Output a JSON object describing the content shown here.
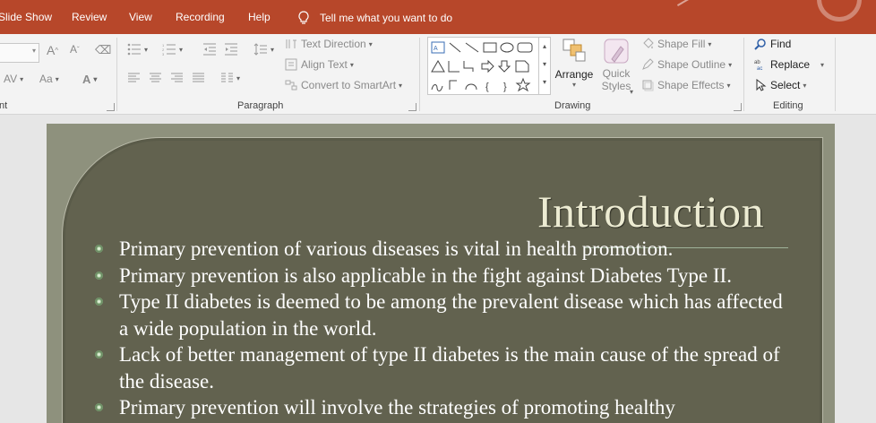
{
  "menu": {
    "tabs": [
      "Slide Show",
      "Review",
      "View",
      "Recording",
      "Help"
    ],
    "tell_me": "Tell me what you want to do"
  },
  "ribbon": {
    "font": {
      "group_label": "nt"
    },
    "paragraph": {
      "group_label": "Paragraph",
      "text_direction": "Text Direction",
      "align_text": "Align Text",
      "convert_smartart": "Convert to SmartArt"
    },
    "drawing": {
      "group_label": "Drawing",
      "arrange": "Arrange",
      "quick_styles_1": "Quick",
      "quick_styles_2": "Styles",
      "shape_fill": "Shape Fill",
      "shape_outline": "Shape Outline",
      "shape_effects": "Shape Effects"
    },
    "editing": {
      "group_label": "Editing",
      "find": "Find",
      "replace": "Replace",
      "select": "Select"
    }
  },
  "slide": {
    "title": "Introduction",
    "bullets": [
      "Primary prevention of various diseases is vital in health promotion.",
      "Primary prevention is also applicable in the fight against Diabetes Type II.",
      "Type II diabetes is deemed to be among the prevalent disease which has affected a wide population in the world.",
      "Lack of better management of type II diabetes is the main cause of the spread of the disease.",
      "Primary prevention will involve the strategies of promoting healthy"
    ]
  },
  "colors": {
    "menubar": "#b7472a",
    "slide_bg": "#8e917d",
    "panel_bg": "#62624f",
    "title_text": "#ecebd2",
    "bullet_accent": "#a5c79a"
  }
}
